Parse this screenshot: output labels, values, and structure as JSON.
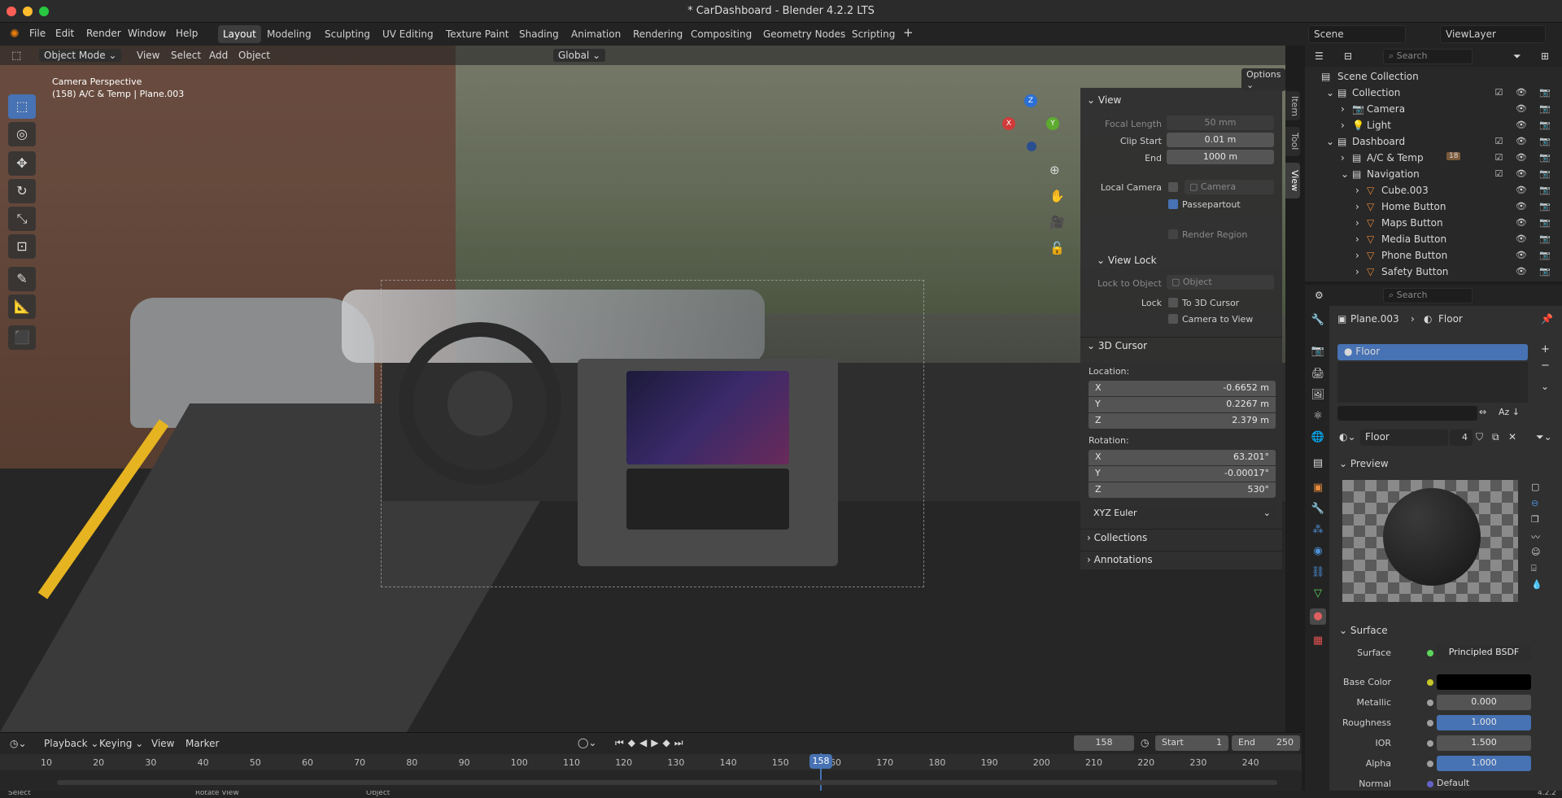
{
  "window": {
    "title": "* CarDashboard - Blender 4.2.2 LTS"
  },
  "menu": {
    "file": "File",
    "edit": "Edit",
    "render": "Render",
    "window": "Window",
    "help": "Help"
  },
  "workspaces": [
    "Layout",
    "Modeling",
    "Sculpting",
    "UV Editing",
    "Texture Paint",
    "Shading",
    "Animation",
    "Rendering",
    "Compositing",
    "Geometry Nodes",
    "Scripting"
  ],
  "scene": {
    "name": "Scene",
    "view_layer": "ViewLayer"
  },
  "viewport_header": {
    "mode": "Object Mode",
    "view": "View",
    "select": "Select",
    "add": "Add",
    "object": "Object",
    "transform": "Global",
    "options": "Options"
  },
  "viewport": {
    "line1": "Camera Perspective",
    "line2": "(158) A/C & Temp | Plane.003"
  },
  "gizmo": {
    "x": "X",
    "y": "Y",
    "z": "Z"
  },
  "npanel": {
    "view_header": "View",
    "focal_length_label": "Focal Length",
    "focal_length": "50 mm",
    "clip_start_label": "Clip Start",
    "clip_start": "0.01 m",
    "end_label": "End",
    "end": "1000 m",
    "local_camera_label": "Local Camera",
    "local_camera_value": "Camera",
    "passepartout": "Passepartout",
    "render_region": "Render Region",
    "view_lock_header": "View Lock",
    "lock_to_object_label": "Lock to Object",
    "lock_to_object_value": "Object",
    "lock_label": "Lock",
    "to_3d_cursor": "To 3D Cursor",
    "camera_to_view": "Camera to View",
    "cursor_header": "3D Cursor",
    "location_label": "Location:",
    "loc": [
      {
        "axis": "X",
        "value": "-0.6652 m"
      },
      {
        "axis": "Y",
        "value": "0.2267 m"
      },
      {
        "axis": "Z",
        "value": "2.379 m"
      }
    ],
    "rotation_label": "Rotation:",
    "rot": [
      {
        "axis": "X",
        "value": "63.201°"
      },
      {
        "axis": "Y",
        "value": "-0.00017°"
      },
      {
        "axis": "Z",
        "value": "530°"
      }
    ],
    "rotation_mode": "XYZ Euler",
    "collections_header": "Collections",
    "annotations_header": "Annotations",
    "tabs": [
      "Item",
      "Tool",
      "View"
    ]
  },
  "outliner": {
    "search_placeholder": "Search",
    "rows": [
      {
        "name": "Scene Collection",
        "indent": 0
      },
      {
        "name": "Collection",
        "indent": 1
      },
      {
        "name": "Camera",
        "indent": 2
      },
      {
        "name": "Light",
        "indent": 2
      },
      {
        "name": "Dashboard",
        "indent": 1
      },
      {
        "name": "A/C & Temp",
        "indent": 2
      },
      {
        "name": "Navigation",
        "indent": 2
      },
      {
        "name": "Cube.003",
        "indent": 3
      },
      {
        "name": "Home Button",
        "indent": 3
      },
      {
        "name": "Maps Button",
        "indent": 3
      },
      {
        "name": "Media Button",
        "indent": 3
      },
      {
        "name": "Phone Button",
        "indent": 3
      },
      {
        "name": "Safety Button",
        "indent": 3
      }
    ],
    "ac_badge": "18"
  },
  "properties": {
    "search_placeholder": "Search",
    "breadcrumb_object": "Plane.003",
    "breadcrumb_material": "Floor",
    "slot_name": "Floor",
    "material_name": "Floor",
    "material_users": "4",
    "preview_header": "Preview",
    "surface_header": "Surface",
    "surface_label": "Surface",
    "surface_value": "Principled BSDF",
    "base_color_label": "Base Color",
    "metallic_label": "Metallic",
    "metallic": "0.000",
    "roughness_label": "Roughness",
    "roughness": "1.000",
    "ior_label": "IOR",
    "ior": "1.500",
    "alpha_label": "Alpha",
    "alpha": "1.000",
    "normal_label": "Normal",
    "normal": "Default"
  },
  "timeline": {
    "playback": "Playback",
    "keying": "Keying",
    "view": "View",
    "marker": "Marker",
    "current_frame": "158",
    "start_label": "Start",
    "start": "1",
    "end_label": "End",
    "end": "250",
    "ticks": [
      "10",
      "20",
      "30",
      "40",
      "50",
      "60",
      "70",
      "80",
      "90",
      "100",
      "110",
      "120",
      "130",
      "140",
      "150",
      "160",
      "170",
      "180",
      "190",
      "200",
      "210",
      "220",
      "230",
      "240"
    ],
    "playhead": "158"
  },
  "status": {
    "select": "Select",
    "rotate": "Rotate View",
    "object": "Object",
    "version": "4.2.2"
  },
  "colors": {
    "accent": "#4772b3",
    "panel": "#303030",
    "header": "#232323"
  }
}
